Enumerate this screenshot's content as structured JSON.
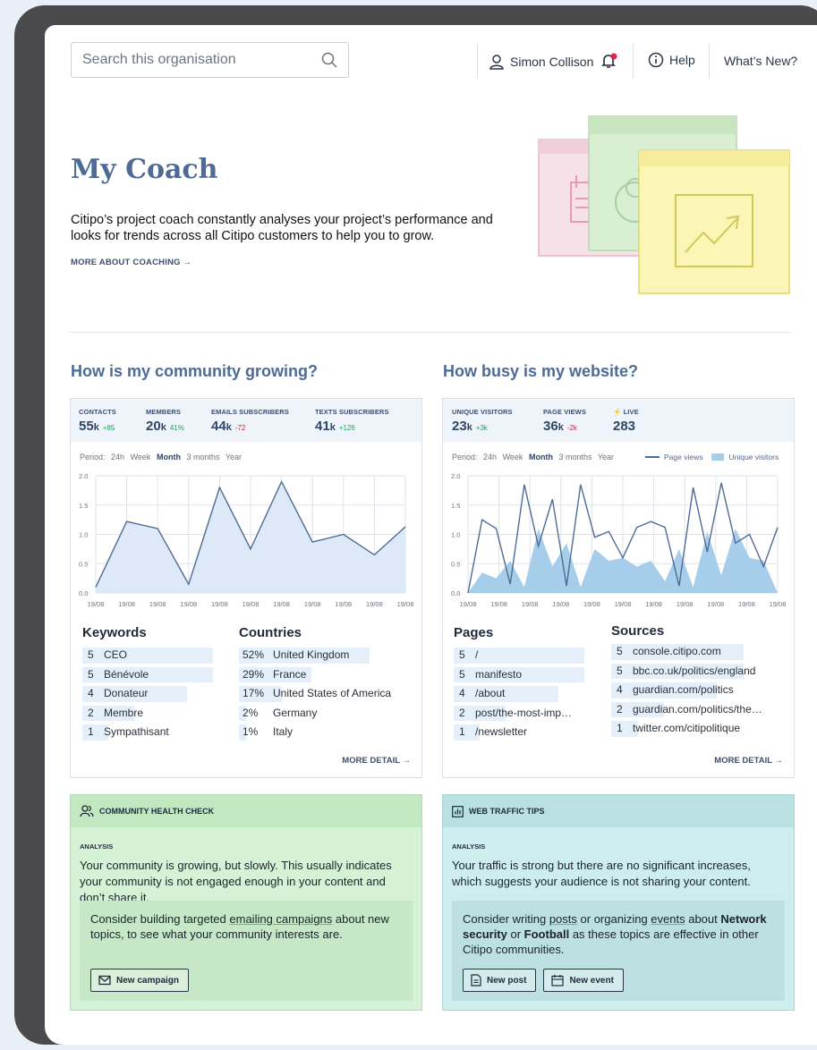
{
  "header": {
    "search_placeholder": "Search this organisation",
    "user_name": "Simon Collison",
    "help_label": "Help",
    "whats_new_label": "What’s New?",
    "notification_dot_color": "#e0234b"
  },
  "hero": {
    "title": "My Coach",
    "description": "Citipo’s project coach constantly analyses your project’s performance and looks for trends across all Citipo customers to help you to grow.",
    "link_label": "MORE ABOUT COACHING →"
  },
  "community": {
    "title": "How is my community growing?",
    "stats": [
      {
        "label": "CONTACTS",
        "value": "55",
        "unit": "k",
        "delta": "+85",
        "trend": "pos"
      },
      {
        "label": "MEMBERS",
        "value": "20",
        "unit": "k",
        "delta": "41%",
        "trend": "pos"
      },
      {
        "label": "EMAILS SUBSCRIBERS",
        "value": "44",
        "unit": "k",
        "delta": "-72",
        "trend": "neg"
      },
      {
        "label": "TEXTS SUBSCRIBERS",
        "value": "41",
        "unit": "k",
        "delta": "+126",
        "trend": "pos"
      }
    ],
    "period": {
      "label": "Period:",
      "options": [
        "24h",
        "Week",
        "Month",
        "3 months",
        "Year"
      ],
      "active": "Month"
    },
    "keywords_title": "Keywords",
    "keywords": [
      {
        "count": "5",
        "name": "CEO",
        "share": 1.0
      },
      {
        "count": "5",
        "name": "Bénévole",
        "share": 1.0
      },
      {
        "count": "4",
        "name": "Donateur",
        "share": 0.8
      },
      {
        "count": "2",
        "name": "Membre",
        "share": 0.4
      },
      {
        "count": "1",
        "name": "Sympathisant",
        "share": 0.2
      }
    ],
    "countries_title": "Countries",
    "countries": [
      {
        "pct": "52%",
        "name": "United Kingdom",
        "share": 0.52
      },
      {
        "pct": "29%",
        "name": "France",
        "share": 0.29
      },
      {
        "pct": "17%",
        "name": "United States of America",
        "share": 0.17
      },
      {
        "pct": "2%",
        "name": "Germany",
        "share": 0.02
      },
      {
        "pct": "1%",
        "name": "Italy",
        "share": 0.01
      }
    ],
    "more_label": "MORE DETAIL →"
  },
  "website": {
    "title": "How busy is my website?",
    "stats": [
      {
        "label": "UNIQUE VISITORS",
        "value": "23",
        "unit": "k",
        "delta": "+3k",
        "trend": "pos"
      },
      {
        "label": "PAGE VIEWS",
        "value": "36",
        "unit": "k",
        "delta": "-2k",
        "trend": "neg"
      },
      {
        "label": "⚡ LIVE",
        "value": "283",
        "unit": "",
        "delta": "",
        "trend": "pos"
      }
    ],
    "period": {
      "label": "Period:",
      "options": [
        "24h",
        "Week",
        "Month",
        "3 months",
        "Year"
      ],
      "active": "Month"
    },
    "legend": {
      "line": "Page views",
      "fill": "Unique visitors"
    },
    "pages_title": "Pages",
    "pages": [
      {
        "count": "5",
        "name": "/",
        "share": 1.0
      },
      {
        "count": "5",
        "name": "manifesto",
        "share": 1.0
      },
      {
        "count": "4",
        "name": "/about",
        "share": 0.8
      },
      {
        "count": "2",
        "name": "post/the-most-imp…",
        "share": 0.4
      },
      {
        "count": "1",
        "name": "/newsletter",
        "share": 0.2
      }
    ],
    "sources_title": "Sources",
    "sources": [
      {
        "count": "5",
        "name": "console.citipo.com",
        "share": 1.0
      },
      {
        "count": "5",
        "name": "bbc.co.uk/politics/england",
        "share": 1.0
      },
      {
        "count": "4",
        "name": "guardian.com/politics",
        "share": 0.8
      },
      {
        "count": "2",
        "name": "guardian.com/politics/the…",
        "share": 0.4
      },
      {
        "count": "1",
        "name": "twitter.com/citipolitique",
        "share": 0.2
      }
    ],
    "more_label": "MORE DETAIL →"
  },
  "chart_data": [
    {
      "type": "area",
      "x": [
        "19/08",
        "19/08",
        "19/08",
        "19/08",
        "19/08",
        "19/08",
        "19/08",
        "19/08",
        "19/08",
        "19/08",
        "19/08"
      ],
      "series": [
        {
          "values": [
            0.1,
            1.22,
            1.1,
            0.15,
            1.8,
            0.75,
            1.9,
            0.87,
            1.0,
            0.65,
            1.13
          ]
        }
      ],
      "ylim": [
        0,
        2.0
      ],
      "yticks": [
        "0.0",
        "0.5",
        "1.0",
        "1.5",
        "2.0"
      ],
      "grid": true,
      "colors": {
        "line": "#4e6a96",
        "fill": "#dde9f6"
      }
    },
    {
      "type": "area",
      "x": [
        "19/08",
        "19/08",
        "19/08",
        "19/08",
        "19/08",
        "19/08",
        "19/08",
        "19/08",
        "19/08",
        "19/08",
        "19/08"
      ],
      "series": [
        {
          "name": "Page views",
          "type": "line",
          "values": [
            0.0,
            1.25,
            1.1,
            0.15,
            1.85,
            0.8,
            1.6,
            0.12,
            1.85,
            0.95,
            1.05,
            0.6,
            1.12,
            1.22,
            1.12,
            0.12,
            1.8,
            0.7,
            1.88,
            0.85,
            1.0,
            0.45,
            1.12
          ]
        },
        {
          "name": "Unique visitors",
          "type": "area",
          "values": [
            0.0,
            0.35,
            0.25,
            0.55,
            0.1,
            1.1,
            0.45,
            0.85,
            0.1,
            0.75,
            0.55,
            0.6,
            0.45,
            0.55,
            0.2,
            0.75,
            0.1,
            1.05,
            0.3,
            1.1,
            0.6,
            0.55,
            0.0
          ]
        }
      ],
      "ylim": [
        0,
        2.0
      ],
      "yticks": [
        "0.0",
        "0.5",
        "1.0",
        "1.5",
        "2.0"
      ],
      "grid": true,
      "legend": "top-right",
      "colors": {
        "line": "#4e6a96",
        "fill": "#a6cde9"
      }
    }
  ],
  "health": {
    "title": "COMMUNITY HEALTH CHECK",
    "analysis_label": "ANALYSIS",
    "analysis_text": "Your community is growing, but slowly. This usually indicates your community is not engaged enough in your content and don’t share it.",
    "advice_pre": "Consider building targeted ",
    "advice_link": "emailing campaigns",
    "advice_post": " about new topics, to see what your community interests are.",
    "button_label": "New campaign"
  },
  "traffic": {
    "title": "WEB TRAFFIC TIPS",
    "analysis_label": "ANALYSIS",
    "analysis_text": "Your traffic is strong but there are no significant increases, which suggests your audience is not sharing your content.",
    "advice_1": "Consider writing ",
    "advice_link_1": "posts",
    "advice_2": " or organizing ",
    "advice_link_2": "events",
    "advice_3": " about ",
    "topic_1": "Network security",
    "advice_4": " or ",
    "topic_2": "Football",
    "advice_5": " as these topics are effective in other Citipo communities.",
    "post_button_label": "New post",
    "event_button_label": "New event"
  }
}
